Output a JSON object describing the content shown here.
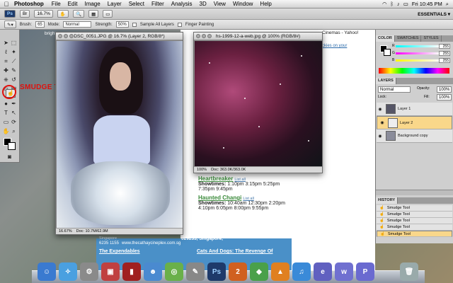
{
  "menubar": {
    "app": "Photoshop",
    "items": [
      "File",
      "Edit",
      "Image",
      "Layer",
      "Select",
      "Filter",
      "Analysis",
      "3D",
      "View",
      "Window",
      "Help"
    ],
    "clock": "Fri 10:45 PM"
  },
  "appbar": {
    "zoom": "16.7%",
    "workspace": "ESSENTIALS ▾"
  },
  "options": {
    "brush_label": "Brush:",
    "brush_size": "65",
    "mode_label": "Mode:",
    "mode_value": "Normal",
    "strength_label": "Strength:",
    "strength_value": "50%",
    "sample_all": "Sample All Layers",
    "finger": "Finger Painting"
  },
  "annotation": {
    "smudge_label": "SMUDGE TOOL"
  },
  "bg": {
    "bright_label": "brigh"
  },
  "doc1": {
    "title": "DSC_0051.JPG @ 16.7% (Layer 2, RGB/8*)",
    "zoom": "16.67%",
    "doc_size": "Doc: 10.7M/62.9M"
  },
  "doc2": {
    "title": "hs-1999-12-a-web.jpg @ 100% (RGB/8#)",
    "zoom": "100%",
    "doc_size": "Doc: 363.0K/363.0K"
  },
  "web": {
    "tab_title": "Cinemas - Yahoo!",
    "tab_link": "ckies on your",
    "movies": [
      {
        "title": "Heartbreaker",
        "list": "List all",
        "label": "Showtimes:",
        "times": "1:10pm 3:15pm 5:25pm 7:35pm 9:45pm"
      },
      {
        "title": "Haunted Changi",
        "list": "List all",
        "label": "Showtimes:",
        "times": "10:40am 12:30pm 2:20pm 4:10pm 6:05pm 8:00pm 9:55pm"
      }
    ],
    "singapore": "Singapore",
    "address": "029233, Singapore,",
    "phone": "6235 1155",
    "url": "www.thecathaycineplex.com.sg",
    "back_to_top": "Back to top",
    "next_left": "The Expendables",
    "next_right": "Cats And Dogs: The Revenge Of"
  },
  "color_panel": {
    "tabs": [
      "COLOR",
      "SWATCHES",
      "STYLES"
    ],
    "r": "255",
    "g": "255",
    "b": "255"
  },
  "layers_panel": {
    "tab": "LAYERS",
    "blend": "Normal",
    "opacity_label": "Opacity:",
    "opacity": "100%",
    "lock_label": "Lock:",
    "fill_label": "Fill:",
    "fill": "100%",
    "layers": [
      {
        "name": "Layer 1",
        "selected": false
      },
      {
        "name": "Layer 2",
        "selected": true
      },
      {
        "name": "Background copy",
        "selected": false
      }
    ]
  },
  "history_panel": {
    "tab": "HISTORY",
    "items": [
      "Smudge Tool",
      "Smudge Tool",
      "Smudge Tool",
      "Smudge Tool",
      "Smudge Tool"
    ]
  },
  "colors": {
    "accent_annotation": "#e0100c",
    "layer_selected": "#f9d78a",
    "link_green": "#3a8a3a"
  }
}
